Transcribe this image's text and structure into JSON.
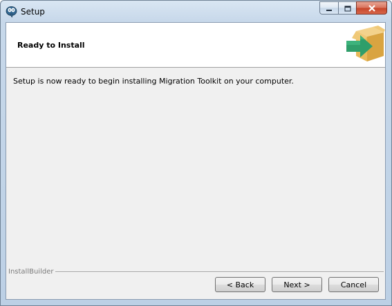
{
  "window": {
    "title": "Setup",
    "app_icon": "postgresql-elephant-icon",
    "caption_buttons": [
      "minimize-icon",
      "maximize-icon",
      "close-icon"
    ]
  },
  "header": {
    "title": "Ready to Install",
    "image": "box-with-green-arrow-icon"
  },
  "body": {
    "message": "Setup is now ready to begin installing Migration Toolkit on your computer."
  },
  "footer": {
    "branding": "InstallBuilder",
    "buttons": {
      "back": "< Back",
      "next": "Next >",
      "cancel": "Cancel"
    }
  },
  "colors": {
    "arrow": "#2f9e6a",
    "box": "#e8b95a",
    "close_button": "#c6452a"
  }
}
